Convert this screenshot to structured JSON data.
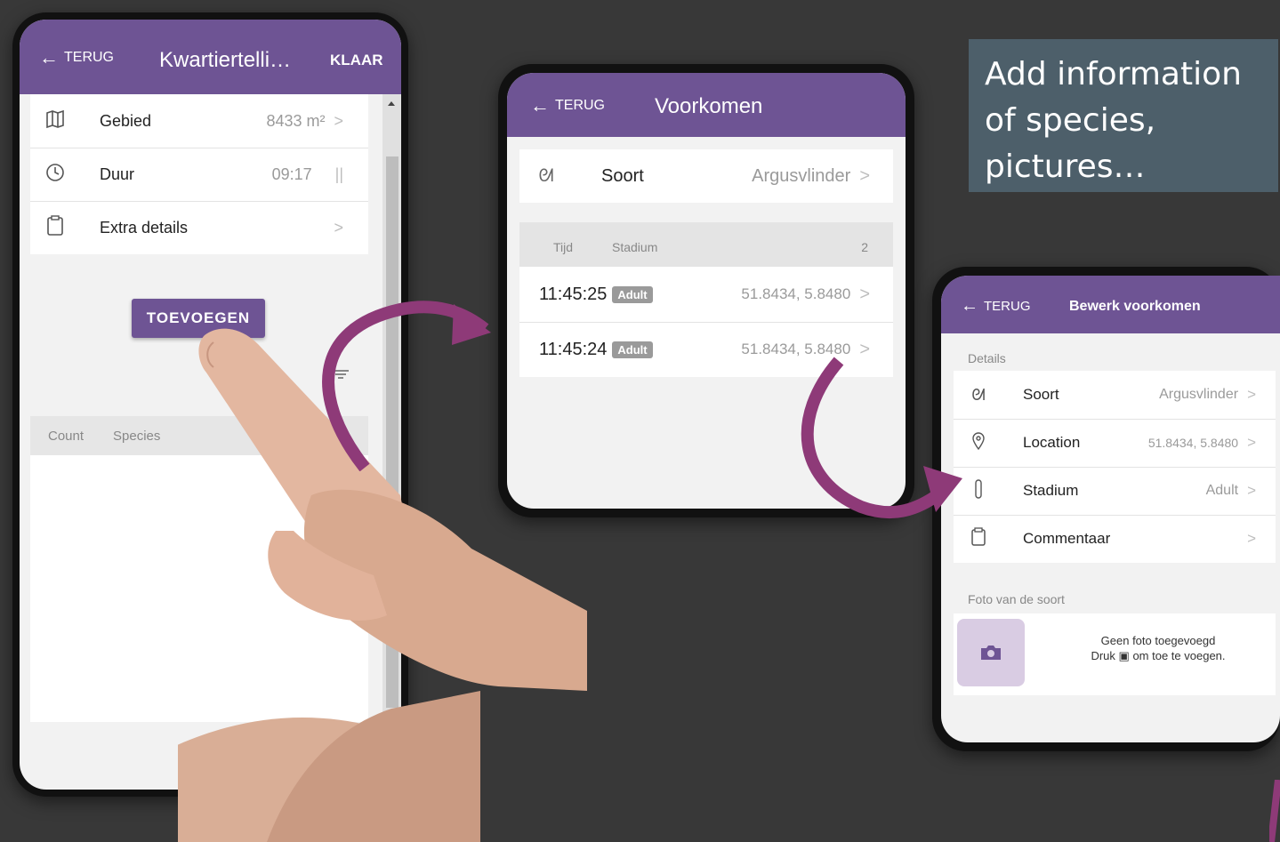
{
  "phone1": {
    "back_label": "TERUG",
    "title": "Kwartiertelli…",
    "done_label": "KLAAR",
    "rows": [
      {
        "icon": "map-icon",
        "label": "Gebied",
        "value": "8433 m²",
        "action": ">"
      },
      {
        "icon": "clock-icon",
        "label": "Duur",
        "value": "09:17",
        "action": "||"
      },
      {
        "icon": "clipboard-icon",
        "label": "Extra details",
        "value": "",
        "action": ">"
      }
    ],
    "add_button": "TOEVOEGEN",
    "table_headers": {
      "count": "Count",
      "species": "Species"
    }
  },
  "phone2": {
    "back_label": "TERUG",
    "title": "Voorkomen",
    "species_label": "Soort",
    "species_value": "Argusvlinder",
    "table_headers": {
      "time": "Tijd",
      "stage": "Stadium",
      "count": "2"
    },
    "rows": [
      {
        "time": "11:45:25",
        "stage": "Adult",
        "coords": "51.8434, 5.8480"
      },
      {
        "time": "11:45:24",
        "stage": "Adult",
        "coords": "51.8434, 5.8480"
      }
    ]
  },
  "phone3": {
    "back_label": "TERUG",
    "title": "Bewerk voorkomen",
    "details_header": "Details",
    "rows": [
      {
        "icon": "butterfly-icon",
        "label": "Soort",
        "value": "Argusvlinder"
      },
      {
        "icon": "location-pin-icon",
        "label": "Location",
        "value": "51.8434, 5.8480"
      },
      {
        "icon": "stage-icon",
        "label": "Stadium",
        "value": "Adult"
      },
      {
        "icon": "clipboard-icon",
        "label": "Commentaar",
        "value": ""
      }
    ],
    "photo_header": "Foto van de soort",
    "photo_line1": "Geen foto toegevoegd",
    "photo_line2_a": "Druk",
    "photo_line2_b": "om toe te voegen."
  },
  "info_text": "Add information of species, pictures…",
  "colors": {
    "accent": "#6e5494",
    "arrow": "#8e3a78",
    "infobox": "#4d5f6a"
  }
}
